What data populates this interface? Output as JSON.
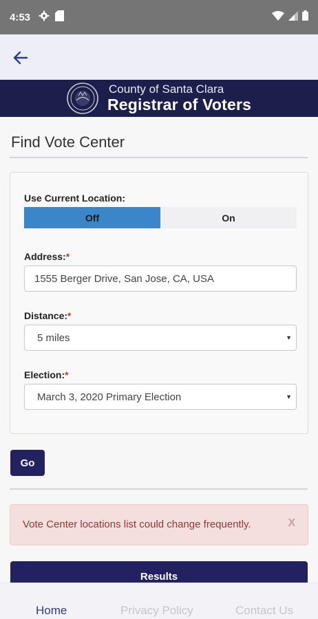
{
  "status_bar": {
    "time": "4:53",
    "icons_left": [
      "settings-icon",
      "sd-card-icon"
    ],
    "icons_right": [
      "wifi-icon",
      "signal-icon",
      "battery-icon"
    ]
  },
  "app_bar": {
    "back_icon": "arrow-left-icon"
  },
  "banner": {
    "subtitle": "County of Santa Clara",
    "title": "Registrar of Voters"
  },
  "page": {
    "title": "Find Vote Center"
  },
  "form": {
    "location_label": "Use Current Location:",
    "toggle_off": "Off",
    "toggle_on": "On",
    "toggle_selected": "Off",
    "address_label": "Address:",
    "address_value": "1555 Berger Drive, San Jose, CA, USA",
    "distance_label": "Distance:",
    "distance_value": "5 miles",
    "election_label": "Election:",
    "election_value": "March 3, 2020 Primary Election",
    "required_marker": "*"
  },
  "go_button": "Go",
  "alert": {
    "text": "Vote Center locations list could change frequently.",
    "close": "X"
  },
  "results_button": "Results",
  "bottom_nav": {
    "home": "Home",
    "privacy": "Privacy Policy",
    "contact": "Contact Us",
    "active": "Home"
  },
  "colors": {
    "banner": "#1c1f4c",
    "accent_blue": "#3a86c8",
    "button": "#23215f",
    "alert_bg": "#f5dede"
  }
}
